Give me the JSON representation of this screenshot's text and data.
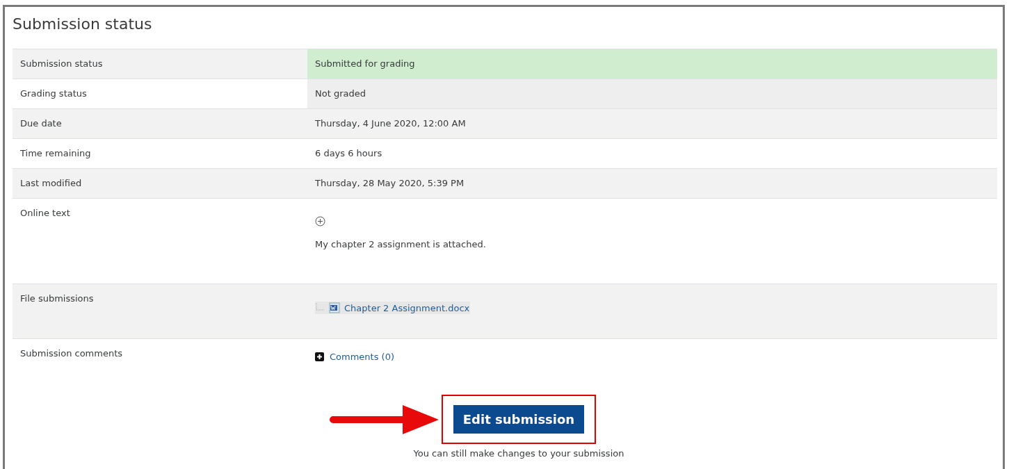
{
  "title": "Submission status",
  "rows": [
    {
      "kind": "text",
      "label": "Submission status",
      "value": "Submitted for grading",
      "color": "#d0edd0"
    },
    {
      "kind": "text",
      "label": "Grading status",
      "value": "Not graded",
      "color": "#eeeeee"
    },
    {
      "kind": "text",
      "label": "Due date",
      "value": "Thursday, 4 June 2020, 12:00 AM"
    },
    {
      "kind": "text",
      "label": "Time remaining",
      "value": "6 days 6 hours"
    },
    {
      "kind": "text",
      "label": "Last modified",
      "value": "Thursday, 28 May 2020, 5:39 PM"
    },
    {
      "kind": "online_text",
      "label": "Online text",
      "value": "My chapter 2 assignment is attached."
    },
    {
      "kind": "file",
      "label": "File submissions",
      "value": "Chapter 2 Assignment.docx"
    },
    {
      "kind": "comments",
      "label": "Submission comments",
      "value": "Comments (0)"
    }
  ],
  "button": {
    "label": "Edit submission",
    "highlighted": true
  },
  "note": "You can still make changes to your submission"
}
